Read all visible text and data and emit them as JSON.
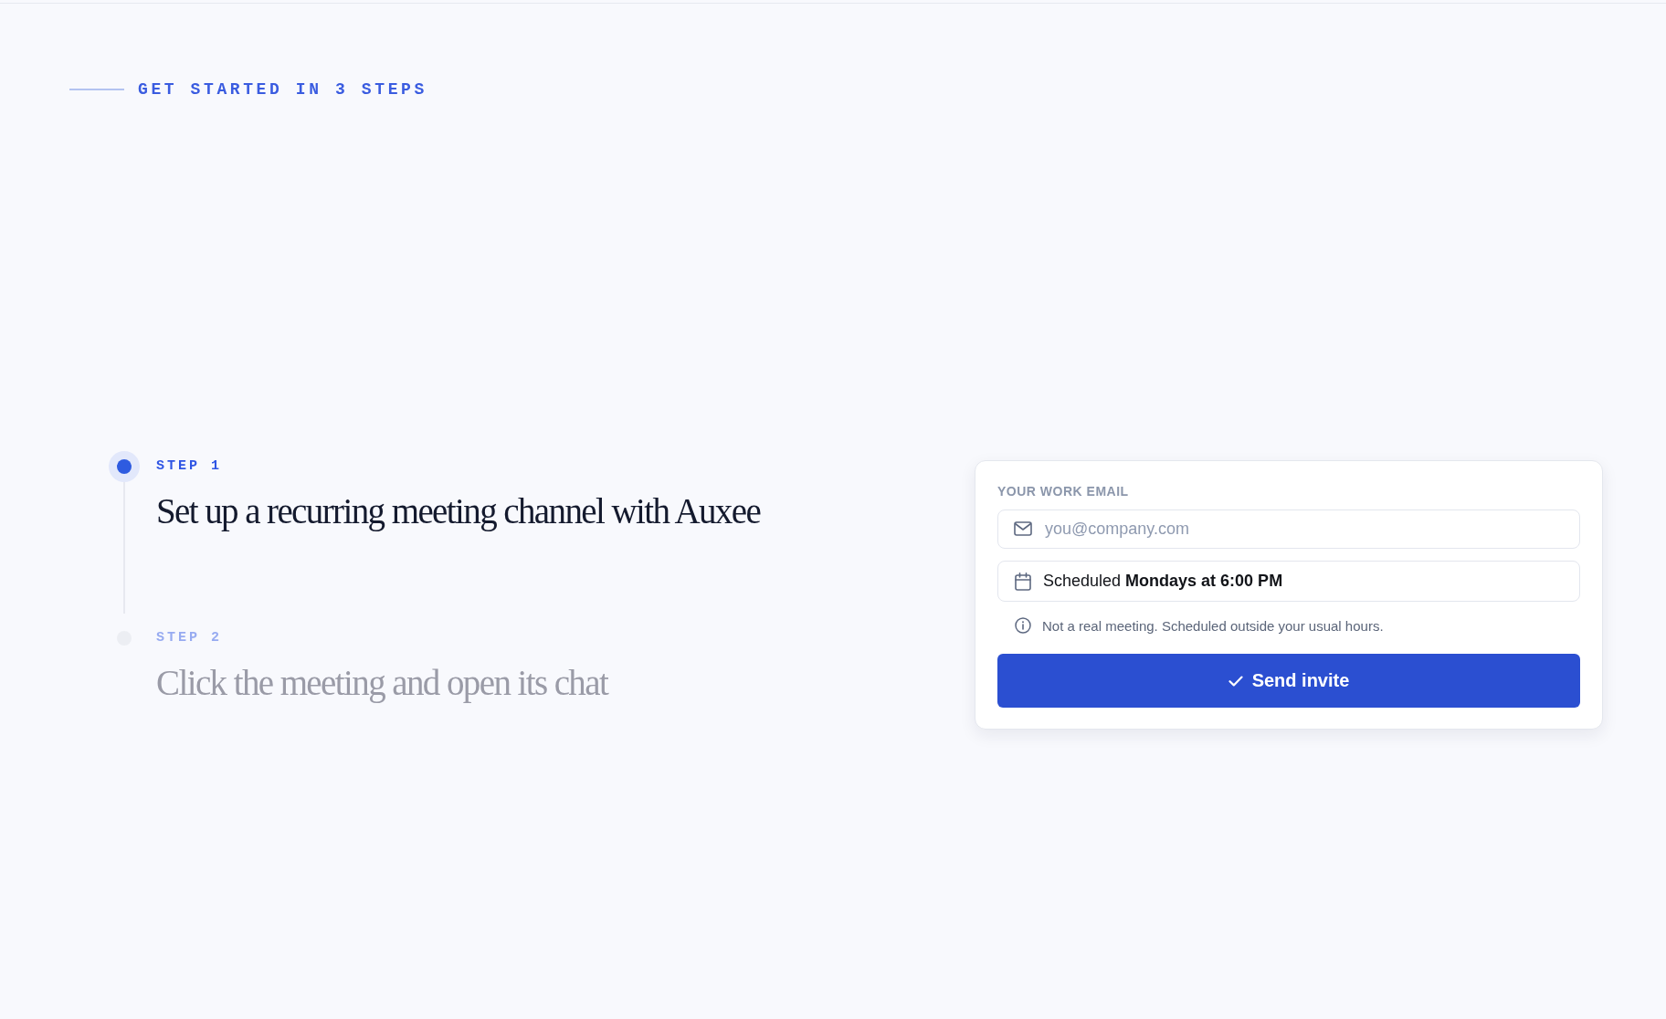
{
  "eyebrow": "GET STARTED IN 3 STEPS",
  "steps": [
    {
      "label": "STEP 1",
      "title": "Set up a recurring meeting channel with Auxee",
      "active": true
    },
    {
      "label": "STEP 2",
      "title": "Click the meeting and open its chat",
      "active": false
    }
  ],
  "invite_card": {
    "email_label": "YOUR WORK EMAIL",
    "email_field": {
      "placeholder": "you@company.com"
    },
    "schedule": "Scheduled **Mondays at 6:00 PM**",
    "note": "Not a real meeting. Scheduled outside your usual hours.",
    "button": "Send invite"
  }
}
